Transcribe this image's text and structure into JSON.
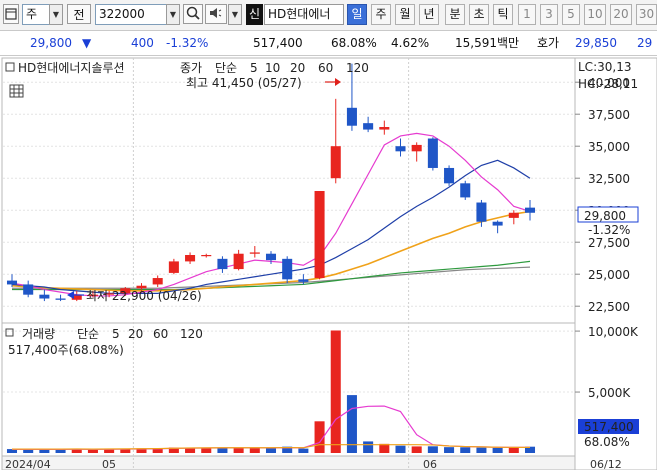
{
  "toolbar": {
    "market": "주",
    "market_dropdown_icon": "chevron-down-icon",
    "prev_label": "전",
    "stock_code": "322000",
    "stock_name": "HD현대에너",
    "new_badge": "신",
    "periods": [
      "일",
      "주",
      "월",
      "년",
      "분",
      "초",
      "틱"
    ],
    "active_period": "일",
    "intervals": [
      "1",
      "3",
      "5",
      "10",
      "20",
      "30"
    ]
  },
  "info": {
    "price": "29,800",
    "direction": "▼",
    "change": "400",
    "change_pct": "-1.32%",
    "volume": "517,400",
    "vol_ratio": "68.08%",
    "turnover": "4.62%",
    "amount": "15,591백만",
    "ask_label": "호가",
    "ask_price": "29,850",
    "extra": "29"
  },
  "chart": {
    "title": "HD현대에너지솔루션",
    "legend_price": "종가",
    "legend_ma_label": "단순",
    "legend_ma": [
      "5",
      "10",
      "20",
      "60",
      "120"
    ],
    "high_annotation": "최고 41,450 (05/27)",
    "low_annotation": "최저 22,900 (04/26)",
    "lc_label": "LC:30,13",
    "hc_label": "HC:-28,11",
    "current_price_tag": "29,800",
    "current_change_tag": "-1.32%",
    "volume_label": "거래량",
    "volume_ma_label": "단순",
    "volume_ma": [
      "5",
      "20",
      "60",
      "120"
    ],
    "volume_today": "517,400주(68.08%)",
    "volume_tag": "517,400",
    "volume_ratio_tag": "68.08%",
    "price_ticks": [
      "40,000",
      "37,500",
      "35,000",
      "32,500",
      "30,000",
      "27,500",
      "25,000",
      "22,500"
    ],
    "volume_ticks": [
      "10,000K",
      "5,000K"
    ],
    "date_ticks": [
      "2024/04",
      "05",
      "06"
    ],
    "date_right": "06/12",
    "colors": {
      "up": "#e8251f",
      "down": "#1f56c7",
      "ma5": "#e63bd0",
      "ma10": "#1f3fa8",
      "ma20": "#f0a21a",
      "ma60": "#2e9a3e",
      "ma120": "#888888"
    }
  },
  "chart_data": {
    "type": "candlestick",
    "title": "HD현대에너지솔루션",
    "ylim": [
      21500,
      41500
    ],
    "candles": [
      {
        "o": 24500,
        "h": 25000,
        "l": 24000,
        "c": 24200
      },
      {
        "o": 24200,
        "h": 24500,
        "l": 23200,
        "c": 23400
      },
      {
        "o": 23400,
        "h": 23800,
        "l": 22900,
        "c": 23100
      },
      {
        "o": 23100,
        "h": 23400,
        "l": 22900,
        "c": 23000
      },
      {
        "o": 23000,
        "h": 23700,
        "l": 22900,
        "c": 23400
      },
      {
        "o": 23400,
        "h": 23700,
        "l": 23200,
        "c": 23400
      },
      {
        "o": 23400,
        "h": 23700,
        "l": 23200,
        "c": 23500
      },
      {
        "o": 23500,
        "h": 24000,
        "l": 23300,
        "c": 23900
      },
      {
        "o": 23900,
        "h": 24300,
        "l": 23700,
        "c": 24100
      },
      {
        "o": 24200,
        "h": 24900,
        "l": 24000,
        "c": 24700
      },
      {
        "o": 25100,
        "h": 26200,
        "l": 25000,
        "c": 26000
      },
      {
        "o": 26000,
        "h": 26700,
        "l": 25800,
        "c": 26500
      },
      {
        "o": 26500,
        "h": 26600,
        "l": 26300,
        "c": 26500
      },
      {
        "o": 26200,
        "h": 26400,
        "l": 25100,
        "c": 25400
      },
      {
        "o": 25400,
        "h": 26900,
        "l": 25300,
        "c": 26600
      },
      {
        "o": 26600,
        "h": 27200,
        "l": 26300,
        "c": 26700
      },
      {
        "o": 26600,
        "h": 26800,
        "l": 25800,
        "c": 26100
      },
      {
        "o": 26200,
        "h": 26400,
        "l": 24300,
        "c": 24600
      },
      {
        "o": 24600,
        "h": 25000,
        "l": 24200,
        "c": 24400
      },
      {
        "o": 24700,
        "h": 31500,
        "l": 24600,
        "c": 31500
      },
      {
        "o": 32500,
        "h": 38700,
        "l": 32100,
        "c": 35000
      },
      {
        "o": 38000,
        "h": 41450,
        "l": 36200,
        "c": 36600
      },
      {
        "o": 36800,
        "h": 37300,
        "l": 36100,
        "c": 36300
      },
      {
        "o": 36300,
        "h": 37000,
        "l": 35900,
        "c": 36500
      },
      {
        "o": 35000,
        "h": 35600,
        "l": 34200,
        "c": 34600
      },
      {
        "o": 34600,
        "h": 35300,
        "l": 33800,
        "c": 35100
      },
      {
        "o": 35600,
        "h": 35700,
        "l": 33100,
        "c": 33300
      },
      {
        "o": 33300,
        "h": 33500,
        "l": 31900,
        "c": 32100
      },
      {
        "o": 32100,
        "h": 32300,
        "l": 30800,
        "c": 31000
      },
      {
        "o": 30600,
        "h": 30800,
        "l": 28700,
        "c": 29100
      },
      {
        "o": 29100,
        "h": 29200,
        "l": 28200,
        "c": 28800
      },
      {
        "o": 29400,
        "h": 30000,
        "l": 28900,
        "c": 29800
      },
      {
        "o": 30200,
        "h": 30800,
        "l": 29200,
        "c": 29800
      }
    ],
    "ma5": [
      24300,
      24100,
      23800,
      23600,
      23400,
      23300,
      23300,
      23400,
      23600,
      23800,
      24200,
      24700,
      25200,
      25500,
      25800,
      26100,
      26000,
      25900,
      25700,
      26400,
      28200,
      30500,
      32800,
      35100,
      35800,
      36000,
      35800,
      35000,
      33900,
      32600,
      31600,
      30300,
      29900
    ],
    "ma10": [
      24200,
      24100,
      24000,
      23800,
      23700,
      23600,
      23500,
      23500,
      23500,
      23500,
      23700,
      23900,
      24200,
      24400,
      24600,
      24800,
      25000,
      25200,
      25400,
      25700,
      26300,
      27000,
      27700,
      28600,
      29500,
      30300,
      31000,
      31800,
      32700,
      33500,
      33900,
      33300,
      32500
    ],
    "ma20": [
      24100,
      24000,
      23950,
      23900,
      23850,
      23800,
      23750,
      23700,
      23700,
      23700,
      23750,
      23800,
      23900,
      24000,
      24100,
      24200,
      24300,
      24400,
      24500,
      24700,
      25000,
      25400,
      25800,
      26300,
      26800,
      27300,
      27800,
      28200,
      28700,
      29100,
      29400,
      29700,
      29900
    ],
    "ma60": [
      23800,
      23800,
      23800,
      23800,
      23800,
      23800,
      23800,
      23800,
      23800,
      23800,
      23800,
      23850,
      23900,
      23950,
      24000,
      24050,
      24100,
      24150,
      24200,
      24350,
      24500,
      24650,
      24800,
      24950,
      25100,
      25200,
      25300,
      25400,
      25500,
      25600,
      25700,
      25850,
      26000
    ],
    "ma120": [
      23900,
      23900,
      23900,
      23900,
      23900,
      23900,
      23900,
      23900,
      23900,
      23900,
      23950,
      24000,
      24050,
      24100,
      24150,
      24200,
      24250,
      24300,
      24350,
      24450,
      24550,
      24650,
      24750,
      24850,
      24950,
      25050,
      25150,
      25250,
      25350,
      25400,
      25450,
      25500,
      25550
    ],
    "volume": [
      320,
      300,
      290,
      280,
      330,
      300,
      340,
      360,
      380,
      400,
      450,
      380,
      420,
      430,
      450,
      420,
      380,
      520,
      360,
      2600,
      10050,
      4750,
      950,
      750,
      600,
      540,
      550,
      480,
      470,
      440,
      420,
      460,
      517.4
    ],
    "volume_ma5": [
      300,
      300,
      300,
      300,
      310,
      300,
      310,
      320,
      330,
      350,
      380,
      400,
      410,
      420,
      420,
      420,
      420,
      440,
      420,
      860,
      2760,
      3650,
      3830,
      3850,
      3400,
      1500,
      680,
      580,
      530,
      500,
      470,
      460,
      460
    ],
    "volume_unit": "K",
    "vol_ylim": [
      0,
      10500
    ]
  }
}
